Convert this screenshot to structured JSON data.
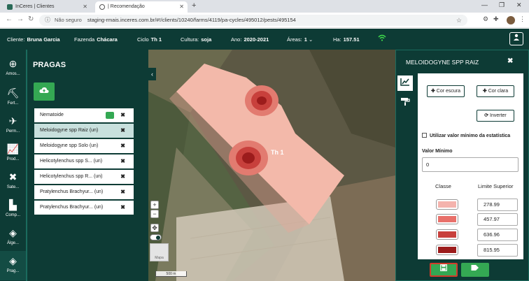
{
  "browser": {
    "tabs": [
      {
        "title": "InCeres | Clientes"
      },
      {
        "title": "| Recomendação"
      }
    ],
    "address": {
      "security": "Não seguro",
      "url": "staging-rmais.inceres.com.br/#!/clients/10240/farms/4119/pa-cycles/495012/pests/495154"
    }
  },
  "header": {
    "client_label": "Cliente:",
    "client_value": "Bruna Garcia",
    "farm_label": "Fazenda",
    "farm_value": "Chácara",
    "cycle_label": "Ciclo",
    "cycle_value": "Th 1",
    "crop_label": "Cultura:",
    "crop_value": "soja",
    "year_label": "Ano:",
    "year_value": "2020-2021",
    "areas_label": "Áreas:",
    "areas_value": "1",
    "ha_label": "Ha:",
    "ha_value": "157.51"
  },
  "rail": {
    "items": [
      {
        "label": "Amos...",
        "icon": "sampling-icon"
      },
      {
        "label": "Fert...",
        "icon": "fertilizer-icon"
      },
      {
        "label": "Perm...",
        "icon": "permission-icon"
      },
      {
        "label": "Prod...",
        "icon": "chart-icon"
      },
      {
        "label": "Sate...",
        "icon": "satellite-icon"
      },
      {
        "label": "Comp...",
        "icon": "compare-icon"
      },
      {
        "label": "Álge...",
        "icon": "layers-icon"
      },
      {
        "label": "Prag...",
        "icon": "pests-icon"
      }
    ]
  },
  "pests": {
    "title": "PRAGAS",
    "items": [
      {
        "label": "Nematoide"
      },
      {
        "label": "Meloidogyne spp Raiz (un)"
      },
      {
        "label": "Meloidogyne spp Solo (un)"
      },
      {
        "label": "Helicotylenchus spp S... (un)"
      },
      {
        "label": "Helicotylenchus spp R... (un)"
      },
      {
        "label": "Pratylenchus Brachyur... (un)"
      },
      {
        "label": "Pratylenchus Brachyur... (un)"
      }
    ]
  },
  "map": {
    "field_label": "Th 1",
    "zoom_in": "+",
    "zoom_out": "−",
    "scale": "500 m",
    "thumb_label": "Mapa"
  },
  "config": {
    "title": "MELOIDOGYNE SPP RAIZ",
    "btn_dark": "Cor escura",
    "btn_light": "Cor clara",
    "btn_invert": "Inverter",
    "use_min": "Utilizar valor mínimo da estatística",
    "min_label": "Valor Mínimo",
    "min_value": "0",
    "col_class": "Classe",
    "col_limit": "Limite Superior",
    "classes": [
      {
        "color": "#f4b3ad",
        "limit": "278.99"
      },
      {
        "color": "#e8706a",
        "limit": "457.97"
      },
      {
        "color": "#c8403c",
        "limit": "636.96"
      },
      {
        "color": "#9c1c1c",
        "limit": "815.95"
      }
    ]
  }
}
